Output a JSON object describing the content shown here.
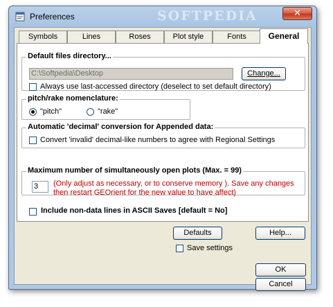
{
  "window": {
    "title": "Preferences",
    "watermark": "SOFTPEDIA",
    "close_glyph": "✕"
  },
  "tabs": [
    {
      "label": "Symbols",
      "active": false
    },
    {
      "label": "Lines",
      "active": false
    },
    {
      "label": "Roses",
      "active": false
    },
    {
      "label": "Plot style",
      "active": false
    },
    {
      "label": "Fonts",
      "active": false
    },
    {
      "label": "General",
      "active": true
    }
  ],
  "default_dir": {
    "legend": "Default files directory...",
    "path_value": "C:\\Softpedia\\Desktop",
    "change_button": "Change...",
    "always_last_label": "Always use last-accessed directory (deselect to set default directory)",
    "always_last_checked": false
  },
  "nomenclature": {
    "legend": "pitch/rake nomenclature:",
    "options": [
      {
        "label": "\"pitch\"",
        "selected": true
      },
      {
        "label": "\"rake\"",
        "selected": false
      }
    ]
  },
  "decimal": {
    "legend": "Automatic 'decimal' conversion for Appended data:",
    "convert_label": "Convert 'invalid' decimal-like numbers to agree with Regional Settings",
    "convert_checked": false
  },
  "max_plots": {
    "legend": "Maximum number of simultaneously open plots (Max. = 99)",
    "value": "3",
    "note": "(Only adjust as necessary, or to conserve memory ). Save any changes then restart GEOrient for the new value to have affect)"
  },
  "non_data_lines": {
    "label": "Include non-data lines in ASCII Saves [default = No]",
    "checked": false
  },
  "footer": {
    "defaults_button": "Defaults",
    "help_button": "Help...",
    "save_settings_label": "Save settings",
    "save_settings_checked": false,
    "ok_button": "OK",
    "cancel_button": "Cancel"
  },
  "colors": {
    "title_bar": "#aec8e6",
    "dialog_bg": "#ece9d8",
    "panel_bg": "#ffffff",
    "note_text": "#c00000",
    "close_button": "#c2381f"
  },
  "icons": {
    "app": "app-window-icon",
    "close": "close-icon"
  }
}
